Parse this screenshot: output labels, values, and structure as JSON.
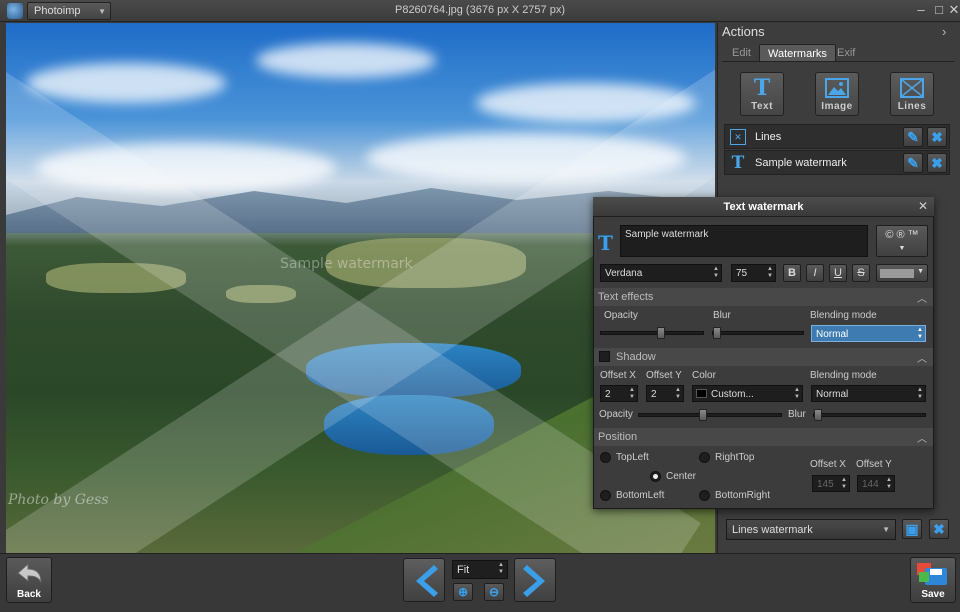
{
  "app": {
    "name": "Photoimp",
    "window_title": "P8260764.jpg (3676 px X 2757 px)"
  },
  "photo": {
    "credit": "Photo by Gess",
    "watermark_text": "Sample watermark"
  },
  "panel": {
    "title": "Actions",
    "tabs": [
      {
        "label": "Edit"
      },
      {
        "label": "Watermarks"
      },
      {
        "label": "Exif"
      }
    ],
    "add_buttons": [
      {
        "label": "Text",
        "icon": "text-icon"
      },
      {
        "label": "Image",
        "icon": "image-icon"
      },
      {
        "label": "Lines",
        "icon": "lines-icon"
      }
    ],
    "watermarks": [
      {
        "name": "Lines",
        "icon": "lines-icon"
      },
      {
        "name": "Sample watermark",
        "icon": "text-icon"
      }
    ],
    "preset": "Lines watermark"
  },
  "dialog": {
    "title": "Text watermark",
    "text_value": "Sample watermark",
    "symbols_button": "© ® ™",
    "font": "Verdana",
    "font_size": "75",
    "style_buttons": [
      "B",
      "I",
      "U",
      "S"
    ],
    "text_effects": {
      "header": "Text effects",
      "opacity_label": "Opacity",
      "opacity_value": 0.6,
      "blur_label": "Blur",
      "blur_value": 0.0,
      "blending_label": "Blending mode",
      "blending_value": "Normal"
    },
    "shadow": {
      "header": "Shadow",
      "offset_x_label": "Offset X",
      "offset_x": "2",
      "offset_y_label": "Offset Y",
      "offset_y": "2",
      "color_label": "Color",
      "color_value": "Custom...",
      "blending_label": "Blending mode",
      "blending_value": "Normal",
      "opacity_label": "Opacity",
      "opacity_value": 0.45,
      "blur_label": "Blur",
      "blur_value": 0.0
    },
    "position": {
      "header": "Position",
      "options": [
        "TopLeft",
        "RightTop",
        "Center",
        "BottomLeft",
        "BottomRight"
      ],
      "selected": "Center",
      "offset_x_label": "Offset X",
      "offset_x": "145",
      "offset_y_label": "Offset Y",
      "offset_y": "144"
    }
  },
  "bottom": {
    "back_label": "Back",
    "zoom_value": "Fit",
    "save_label": "Save"
  },
  "colors": {
    "accent": "#3aa0ee",
    "panel_bg": "#3d3d3d",
    "dark_field": "#1e1e1e",
    "selected_field": "#3d7bb0"
  }
}
